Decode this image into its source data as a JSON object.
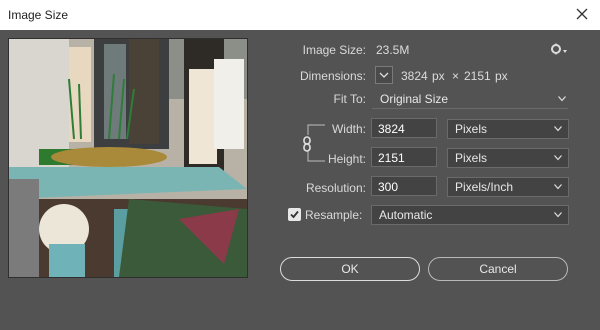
{
  "window": {
    "title": "Image Size"
  },
  "image_size": {
    "label": "Image Size:",
    "value": "23.5M"
  },
  "dimensions": {
    "label": "Dimensions:",
    "width": "3824",
    "unit1": "px",
    "times": "×",
    "height": "2151",
    "unit2": "px"
  },
  "fit_to": {
    "label": "Fit To:",
    "value": "Original Size"
  },
  "width": {
    "label": "Width:",
    "value": "3824",
    "unit": "Pixels"
  },
  "height": {
    "label": "Height:",
    "value": "2151",
    "unit": "Pixels"
  },
  "resolution": {
    "label": "Resolution:",
    "value": "300",
    "unit": "Pixels/Inch"
  },
  "resample": {
    "label": "Resample:",
    "checked": true,
    "method": "Automatic"
  },
  "buttons": {
    "ok": "OK",
    "cancel": "Cancel"
  },
  "colors": {
    "dialog_bg": "#535353",
    "field_bg": "#434343",
    "title_bg": "#ffffff"
  },
  "icons": [
    "close-icon",
    "gear-icon",
    "dimensions-dropdown-icon",
    "link-icon",
    "chevron-down-icon",
    "checkbox-icon"
  ]
}
